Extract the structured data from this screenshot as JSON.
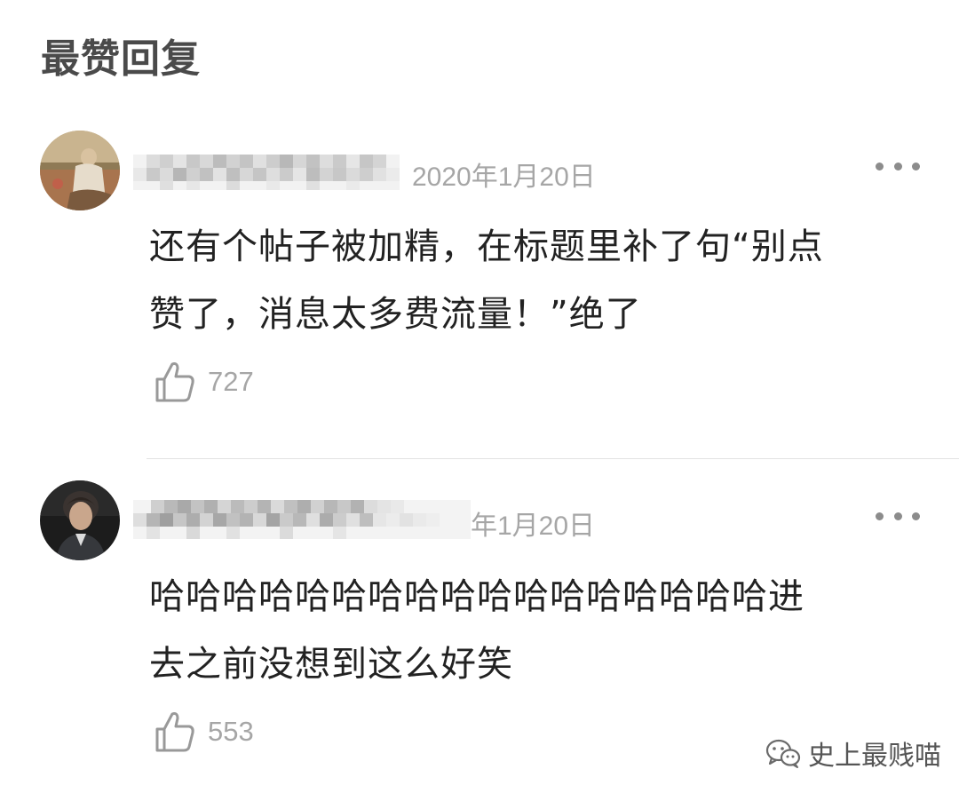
{
  "section": {
    "title": "最赞回复"
  },
  "comments": [
    {
      "date": "2020年1月20日",
      "text_lines": [
        "还有个帖子被加精，在标题里补了句“别点",
        "赞了，消息太多费流量！”绝了"
      ],
      "likes": "727",
      "avatar_icon": "painting-avatar-icon"
    },
    {
      "date": "年1月20日",
      "text_lines": [
        "哈哈哈哈哈哈哈哈哈哈哈哈哈哈哈哈哈进",
        "去之前没想到这么好笑"
      ],
      "likes": "553",
      "avatar_icon": "portrait-avatar-icon"
    }
  ],
  "watermark": {
    "text": "史上最贱喵"
  },
  "colors": {
    "title": "#4a4a4a",
    "body_text": "#222222",
    "meta_text": "#a6a6a6",
    "divider": "#e3e3e3"
  }
}
